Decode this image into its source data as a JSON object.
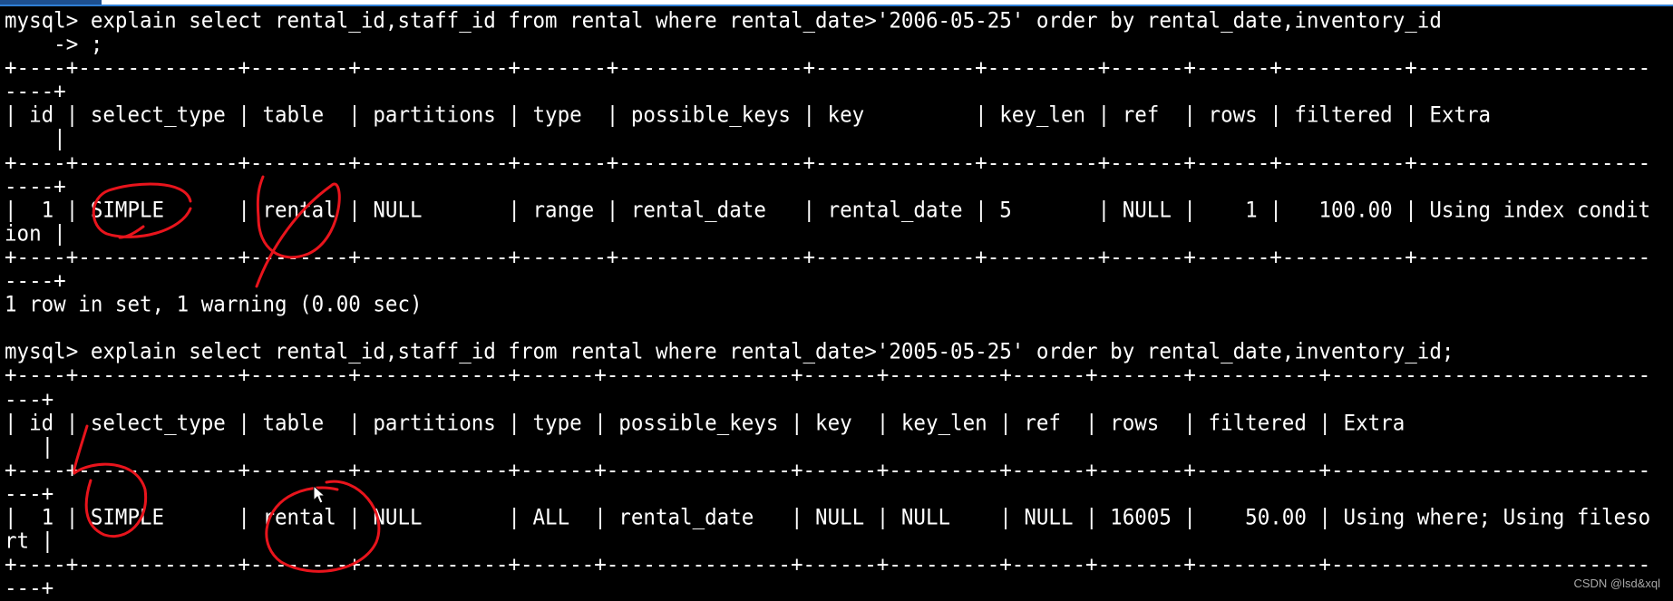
{
  "terminal": {
    "prompt": "mysql> ",
    "columns": 134,
    "sessions": [
      {
        "query_lines": [
          "explain select rental_id,staff_id from rental where rental_date>'2006-05-25' order by rental_date,inventory_id",
          "    -> ;"
        ],
        "headers": [
          "id",
          "select_type",
          "table",
          "partitions",
          "type",
          "possible_keys",
          "key",
          "key_len",
          "ref",
          "rows",
          "filtered",
          "Extra"
        ],
        "right_align": [
          true,
          false,
          false,
          false,
          false,
          false,
          false,
          false,
          false,
          true,
          true,
          false
        ],
        "rows": [
          [
            "1",
            "SIMPLE",
            "rental",
            "NULL",
            "range",
            "rental_date",
            "rental_date",
            "5",
            "NULL",
            "1",
            "100.00",
            "Using index condition"
          ]
        ],
        "status": "1 row in set, 1 warning (0.00 sec)"
      },
      {
        "query_lines": [
          "explain select rental_id,staff_id from rental where rental_date>'2005-05-25' order by rental_date,inventory_id;"
        ],
        "headers": [
          "id",
          "select_type",
          "table",
          "partitions",
          "type",
          "possible_keys",
          "key",
          "key_len",
          "ref",
          "rows",
          "filtered",
          "Extra"
        ],
        "right_align": [
          true,
          false,
          false,
          false,
          false,
          false,
          false,
          false,
          false,
          true,
          true,
          false
        ],
        "rows": [
          [
            "1",
            "SIMPLE",
            "rental",
            "NULL",
            "ALL",
            "rental_date",
            "NULL",
            "NULL",
            "NULL",
            "16005",
            "50.00",
            "Using where; Using filesort"
          ]
        ],
        "status": ""
      }
    ]
  },
  "colors": {
    "annotation": "#e8141c",
    "text": "#ffffff",
    "background": "#000000"
  },
  "watermark": "CSDN @lsd&xql"
}
